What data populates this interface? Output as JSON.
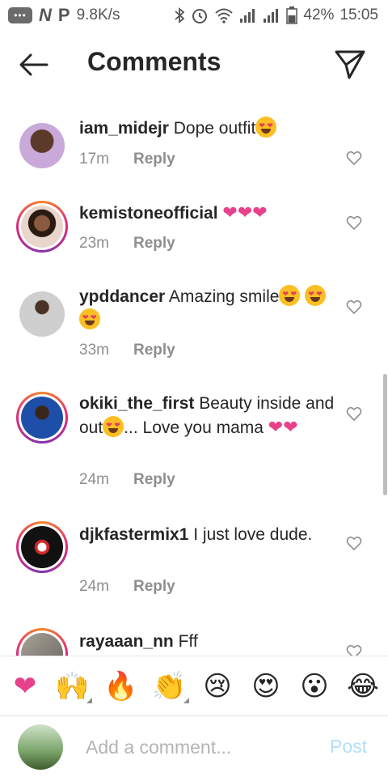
{
  "status_bar": {
    "speed": "9.8K/s",
    "battery": "42%",
    "time": "15:05"
  },
  "header": {
    "title": "Comments"
  },
  "comments": [
    {
      "username": "iam_midejr",
      "text": "Dope outfit",
      "time": "17m",
      "reply_label": "Reply"
    },
    {
      "username": "kemistoneofficial",
      "text": "",
      "time": "23m",
      "reply_label": "Reply"
    },
    {
      "username": "ypddancer",
      "text": "Amazing smile",
      "time": "33m",
      "reply_label": "Reply"
    },
    {
      "username": "okiki_the_first",
      "text": "Beauty inside and out",
      "text_2": "... Love you mama",
      "time": "24m",
      "reply_label": "Reply"
    },
    {
      "username": "djkfastermix1",
      "text": "I just love dude.",
      "time": "24m",
      "reply_label": "Reply"
    },
    {
      "username": "rayaaan_nn",
      "text": "Fff",
      "time": "",
      "reply_label": ""
    }
  ],
  "emoji_bar": [
    "❤",
    "🙌",
    "🔥",
    "👏",
    "😢",
    "😍",
    "😮",
    "😂"
  ],
  "composer": {
    "placeholder": "Add a comment...",
    "post_label": "Post"
  },
  "colors": {
    "accent_blue_disabled": "#b2dffc",
    "muted": "#8e8e8e",
    "story_ring": "#dd2a7b",
    "pink_heart": "#e8418b"
  },
  "icons": [
    "chat-bubble-icon",
    "n-app-icon",
    "p-app-icon",
    "bluetooth-icon",
    "alarm-icon",
    "wifi-icon",
    "signal-icon",
    "battery-icon",
    "back-arrow-icon",
    "send-icon",
    "heart-outline-icon"
  ]
}
